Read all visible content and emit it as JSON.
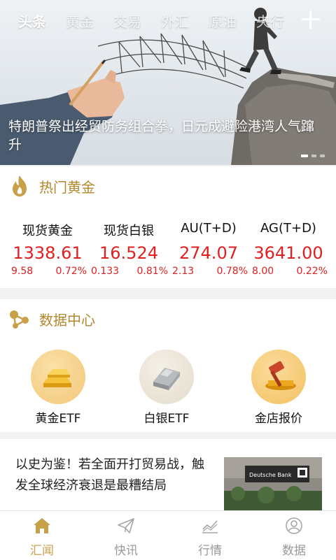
{
  "tabs": [
    "头条",
    "黄金",
    "交易",
    "外汇",
    "原油",
    "央行"
  ],
  "banner": {
    "caption": "特朗普祭出经贸防务组合拳，日元成避险港湾人气蹿升"
  },
  "hot_gold": {
    "title": "热门黄金",
    "quotes": [
      {
        "name": "现货黄金",
        "price": "1338.61",
        "change": "9.58",
        "percent": "0.72%"
      },
      {
        "name": "现货白银",
        "price": "16.524",
        "change": "0.133",
        "percent": "0.81%"
      },
      {
        "name": "AU(T+D)",
        "price": "274.07",
        "change": "2.13",
        "percent": "0.78%"
      },
      {
        "name": "AG(T+D)",
        "price": "3641.00",
        "change": "8.00",
        "percent": "0.22%"
      }
    ]
  },
  "data_center": {
    "title": "数据中心",
    "items": [
      {
        "label": "黄金ETF",
        "icon": "gold-bars-icon"
      },
      {
        "label": "白银ETF",
        "icon": "silver-bars-icon"
      },
      {
        "label": "金店报价",
        "icon": "gavel-icon"
      }
    ]
  },
  "news": {
    "title": "以史为鉴！若全面开打贸易战，触发全球经济衰退是最糟结局",
    "thumb_text": "Deutsche Bank"
  },
  "bottom_nav": [
    {
      "label": "汇闻",
      "icon": "home-icon",
      "active": true
    },
    {
      "label": "快讯",
      "icon": "paper-plane-icon",
      "active": false
    },
    {
      "label": "行情",
      "icon": "chart-icon",
      "active": false
    },
    {
      "label": "数据",
      "icon": "user-icon",
      "active": false
    }
  ],
  "colors": {
    "accent": "#c9a04a",
    "section_title": "#b3872d",
    "price_up": "#e02020"
  }
}
